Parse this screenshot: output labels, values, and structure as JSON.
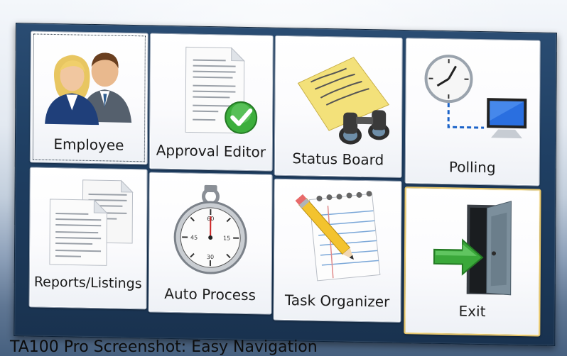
{
  "menu": {
    "tiles": [
      {
        "label": "Employee",
        "icon": "people-icon"
      },
      {
        "label": "Approval Editor",
        "icon": "approved-document-icon"
      },
      {
        "label": "Status Board",
        "icon": "binoculars-notes-icon"
      },
      {
        "label": "Polling",
        "icon": "clock-monitor-icon"
      },
      {
        "label": "Reports/Listings",
        "icon": "documents-icon"
      },
      {
        "label": "Auto Process",
        "icon": "stopwatch-icon"
      },
      {
        "label": "Task Organizer",
        "icon": "notepad-pencil-icon"
      },
      {
        "label": "Exit",
        "icon": "exit-door-icon"
      }
    ]
  },
  "caption": "TA100 Pro Screenshot: Easy Navigation",
  "colors": {
    "panel": "#1f3f63",
    "selected_border": "#e7c66a",
    "check_green": "#3cae3c"
  }
}
